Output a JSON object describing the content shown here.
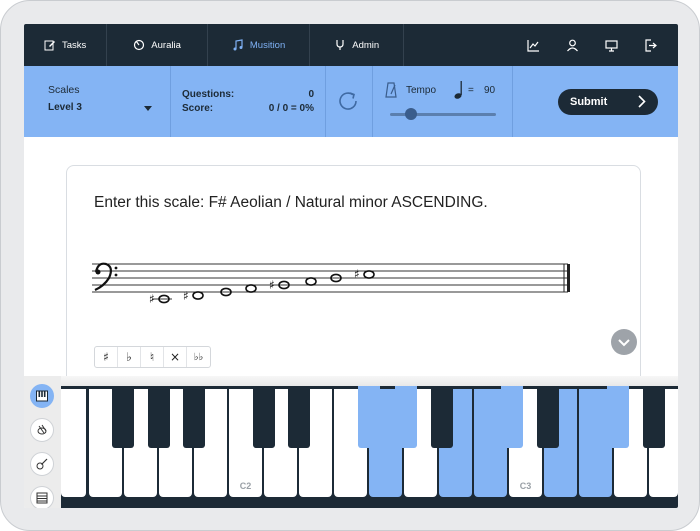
{
  "nav": {
    "tabs": [
      {
        "label": "Tasks",
        "icon": "edit-icon",
        "active": false
      },
      {
        "label": "Auralia",
        "icon": "auralia-icon",
        "active": false
      },
      {
        "label": "Musition",
        "icon": "musition-icon",
        "active": true
      },
      {
        "label": "Admin",
        "icon": "stethoscope-icon",
        "active": false
      }
    ],
    "right_icons": [
      "chart-icon",
      "user-icon",
      "monitor-icon",
      "logout-icon"
    ]
  },
  "controls": {
    "topic": "Scales",
    "level": "Level 3",
    "questions_label": "Questions:",
    "questions_value": "0",
    "score_label": "Score:",
    "score_value": "0 / 0 = 0%",
    "tempo_label": "Tempo",
    "tempo_eq": "=",
    "tempo_value": "90",
    "tempo_fraction": 0.2,
    "submit_label": "Submit"
  },
  "question": {
    "text": "Enter this scale: F# Aeolian / Natural minor ASCENDING."
  },
  "accidentals": [
    "♯",
    "♭",
    "♮",
    "×",
    "♭♭"
  ],
  "keyboard": {
    "labels": {
      "c2": "C2",
      "c3": "C3"
    }
  },
  "colors": {
    "navy": "#1c2a36",
    "accent_blue": "#84b4f4"
  }
}
